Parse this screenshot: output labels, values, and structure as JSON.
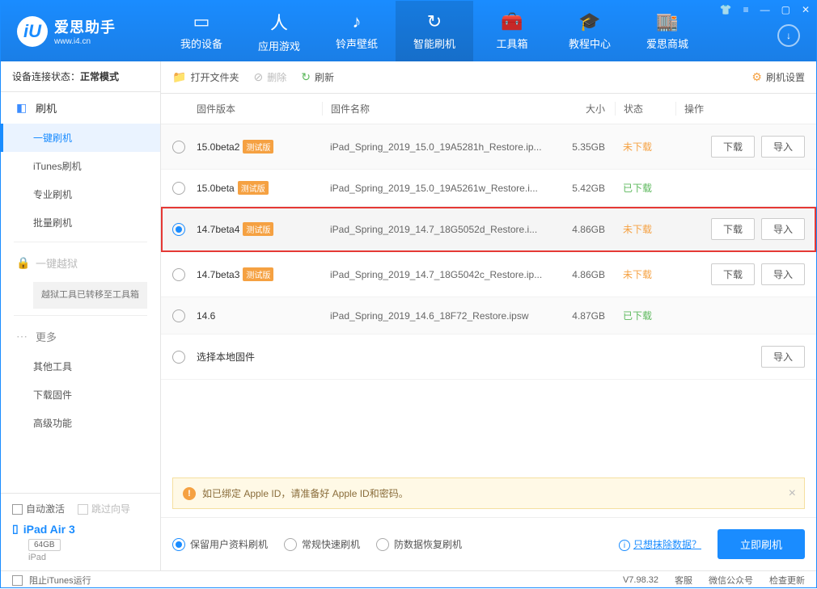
{
  "app": {
    "title": "爱思助手",
    "url": "www.i4.cn"
  },
  "nav": [
    {
      "label": "我的设备"
    },
    {
      "label": "应用游戏"
    },
    {
      "label": "铃声壁纸"
    },
    {
      "label": "智能刷机"
    },
    {
      "label": "工具箱"
    },
    {
      "label": "教程中心"
    },
    {
      "label": "爱思商城"
    }
  ],
  "sidebar": {
    "status_label": "设备连接状态：",
    "status_value": "正常模式",
    "group_flash": "刷机",
    "items_flash": [
      "一键刷机",
      "iTunes刷机",
      "专业刷机",
      "批量刷机"
    ],
    "group_jailbreak": "一键越狱",
    "jailbreak_note": "越狱工具已转移至工具箱",
    "group_more": "更多",
    "items_more": [
      "其他工具",
      "下载固件",
      "高级功能"
    ],
    "auto_activate": "自动激活",
    "skip_guide": "跳过向导",
    "device_name": "iPad Air 3",
    "storage": "64GB",
    "device_type": "iPad"
  },
  "toolbar": {
    "open_folder": "打开文件夹",
    "delete": "删除",
    "refresh": "刷新",
    "settings": "刷机设置"
  },
  "table": {
    "headers": {
      "version": "固件版本",
      "name": "固件名称",
      "size": "大小",
      "status": "状态",
      "action": "操作"
    },
    "rows": [
      {
        "version": "15.0beta2",
        "badge": "测试版",
        "name": "iPad_Spring_2019_15.0_19A5281h_Restore.ip...",
        "size": "5.35GB",
        "status": "未下载",
        "status_color": "orange",
        "actions": [
          "下载",
          "导入"
        ],
        "selected": false
      },
      {
        "version": "15.0beta",
        "badge": "测试版",
        "name": "iPad_Spring_2019_15.0_19A5261w_Restore.i...",
        "size": "5.42GB",
        "status": "已下载",
        "status_color": "green",
        "actions": [],
        "selected": false
      },
      {
        "version": "14.7beta4",
        "badge": "测试版",
        "name": "iPad_Spring_2019_14.7_18G5052d_Restore.i...",
        "size": "4.86GB",
        "status": "未下载",
        "status_color": "orange",
        "actions": [
          "下载",
          "导入"
        ],
        "selected": true,
        "highlighted": true
      },
      {
        "version": "14.7beta3",
        "badge": "测试版",
        "name": "iPad_Spring_2019_14.7_18G5042c_Restore.ip...",
        "size": "4.86GB",
        "status": "未下载",
        "status_color": "orange",
        "actions": [
          "下载",
          "导入"
        ],
        "selected": false
      },
      {
        "version": "14.6",
        "badge": "",
        "name": "iPad_Spring_2019_14.6_18F72_Restore.ipsw",
        "size": "4.87GB",
        "status": "已下载",
        "status_color": "green",
        "actions": [],
        "selected": false
      },
      {
        "version": "",
        "badge": "",
        "name_in_version": "选择本地固件",
        "size": "",
        "status": "",
        "status_color": "",
        "actions": [
          "导入"
        ],
        "selected": false
      }
    ]
  },
  "warning": "如已绑定 Apple ID，请准备好 Apple ID和密码。",
  "options": {
    "opt1": "保留用户资料刷机",
    "opt2": "常规快速刷机",
    "opt3": "防数据恢复刷机",
    "link": "只想抹除数据？",
    "flash_btn": "立即刷机"
  },
  "footer": {
    "block_itunes": "阻止iTunes运行",
    "version": "V7.98.32",
    "service": "客服",
    "wechat": "微信公众号",
    "update": "检查更新"
  }
}
